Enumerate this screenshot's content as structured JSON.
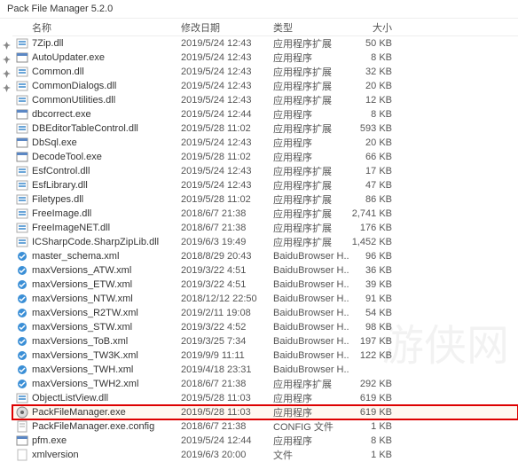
{
  "window": {
    "title": "Pack File Manager 5.2.0"
  },
  "headers": {
    "name": "名称",
    "date": "修改日期",
    "type": "类型",
    "size": "大小"
  },
  "pins": [
    "✦",
    "✦",
    "✦",
    "✦"
  ],
  "files": [
    {
      "icon": "dll",
      "name": "7Zip.dll",
      "date": "2019/5/24 12:43",
      "type": "应用程序扩展",
      "size": "50 KB",
      "hl": false
    },
    {
      "icon": "exe",
      "name": "AutoUpdater.exe",
      "date": "2019/5/24 12:43",
      "type": "应用程序",
      "size": "8 KB",
      "hl": false
    },
    {
      "icon": "dll",
      "name": "Common.dll",
      "date": "2019/5/24 12:43",
      "type": "应用程序扩展",
      "size": "32 KB",
      "hl": false
    },
    {
      "icon": "dll",
      "name": "CommonDialogs.dll",
      "date": "2019/5/24 12:43",
      "type": "应用程序扩展",
      "size": "20 KB",
      "hl": false
    },
    {
      "icon": "dll",
      "name": "CommonUtilities.dll",
      "date": "2019/5/24 12:43",
      "type": "应用程序扩展",
      "size": "12 KB",
      "hl": false
    },
    {
      "icon": "exe",
      "name": "dbcorrect.exe",
      "date": "2019/5/24 12:44",
      "type": "应用程序",
      "size": "8 KB",
      "hl": false
    },
    {
      "icon": "dll",
      "name": "DBEditorTableControl.dll",
      "date": "2019/5/28 11:02",
      "type": "应用程序扩展",
      "size": "593 KB",
      "hl": false
    },
    {
      "icon": "exe",
      "name": "DbSql.exe",
      "date": "2019/5/24 12:43",
      "type": "应用程序",
      "size": "20 KB",
      "hl": false
    },
    {
      "icon": "exe",
      "name": "DecodeTool.exe",
      "date": "2019/5/28 11:02",
      "type": "应用程序",
      "size": "66 KB",
      "hl": false
    },
    {
      "icon": "dll",
      "name": "EsfControl.dll",
      "date": "2019/5/24 12:43",
      "type": "应用程序扩展",
      "size": "17 KB",
      "hl": false
    },
    {
      "icon": "dll",
      "name": "EsfLibrary.dll",
      "date": "2019/5/24 12:43",
      "type": "应用程序扩展",
      "size": "47 KB",
      "hl": false
    },
    {
      "icon": "dll",
      "name": "Filetypes.dll",
      "date": "2019/5/28 11:02",
      "type": "应用程序扩展",
      "size": "86 KB",
      "hl": false
    },
    {
      "icon": "dll",
      "name": "FreeImage.dll",
      "date": "2018/6/7 21:38",
      "type": "应用程序扩展",
      "size": "2,741 KB",
      "hl": false
    },
    {
      "icon": "dll",
      "name": "FreeImageNET.dll",
      "date": "2018/6/7 21:38",
      "type": "应用程序扩展",
      "size": "176 KB",
      "hl": false
    },
    {
      "icon": "dll",
      "name": "ICSharpCode.SharpZipLib.dll",
      "date": "2019/6/3 19:49",
      "type": "应用程序扩展",
      "size": "1,452 KB",
      "hl": false
    },
    {
      "icon": "xml",
      "name": "master_schema.xml",
      "date": "2018/8/29 20:43",
      "type": "BaiduBrowser H...",
      "size": "96 KB",
      "hl": false
    },
    {
      "icon": "xml",
      "name": "maxVersions_ATW.xml",
      "date": "2019/3/22 4:51",
      "type": "BaiduBrowser H...",
      "size": "36 KB",
      "hl": false
    },
    {
      "icon": "xml",
      "name": "maxVersions_ETW.xml",
      "date": "2019/3/22 4:51",
      "type": "BaiduBrowser H...",
      "size": "39 KB",
      "hl": false
    },
    {
      "icon": "xml",
      "name": "maxVersions_NTW.xml",
      "date": "2018/12/12 22:50",
      "type": "BaiduBrowser H...",
      "size": "91 KB",
      "hl": false
    },
    {
      "icon": "xml",
      "name": "maxVersions_R2TW.xml",
      "date": "2019/2/11 19:08",
      "type": "BaiduBrowser H...",
      "size": "54 KB",
      "hl": false
    },
    {
      "icon": "xml",
      "name": "maxVersions_STW.xml",
      "date": "2019/3/22 4:52",
      "type": "BaiduBrowser H...",
      "size": "98 KB",
      "hl": false
    },
    {
      "icon": "xml",
      "name": "maxVersions_ToB.xml",
      "date": "2019/3/25 7:34",
      "type": "BaiduBrowser H...",
      "size": "197 KB",
      "hl": false
    },
    {
      "icon": "xml",
      "name": "maxVersions_TW3K.xml",
      "date": "2019/9/9 11:11",
      "type": "BaiduBrowser H...",
      "size": "122 KB",
      "hl": false
    },
    {
      "icon": "xml",
      "name": "maxVersions_TWH.xml",
      "date": "2019/4/18 23:31",
      "type": "BaiduBrowser H...",
      "size": "",
      "hl": false
    },
    {
      "icon": "xml",
      "name": "maxVersions_TWH2.xml",
      "date": "2018/6/7 21:38",
      "type": "应用程序扩展",
      "size": "292 KB",
      "hl": false
    },
    {
      "icon": "dll",
      "name": "ObjectListView.dll",
      "date": "2019/5/28 11:03",
      "type": "应用程序",
      "size": "619 KB",
      "hl": false
    },
    {
      "icon": "app",
      "name": "PackFileManager.exe",
      "date": "2019/5/28 11:03",
      "type": "应用程序",
      "size": "619 KB",
      "hl": true
    },
    {
      "icon": "cfg",
      "name": "PackFileManager.exe.config",
      "date": "2018/6/7 21:38",
      "type": "CONFIG 文件",
      "size": "1 KB",
      "hl": false
    },
    {
      "icon": "exe",
      "name": "pfm.exe",
      "date": "2019/5/24 12:44",
      "type": "应用程序",
      "size": "8 KB",
      "hl": false
    },
    {
      "icon": "file",
      "name": "xmlversion",
      "date": "2019/6/3 20:00",
      "type": "文件",
      "size": "1 KB",
      "hl": false
    }
  ]
}
